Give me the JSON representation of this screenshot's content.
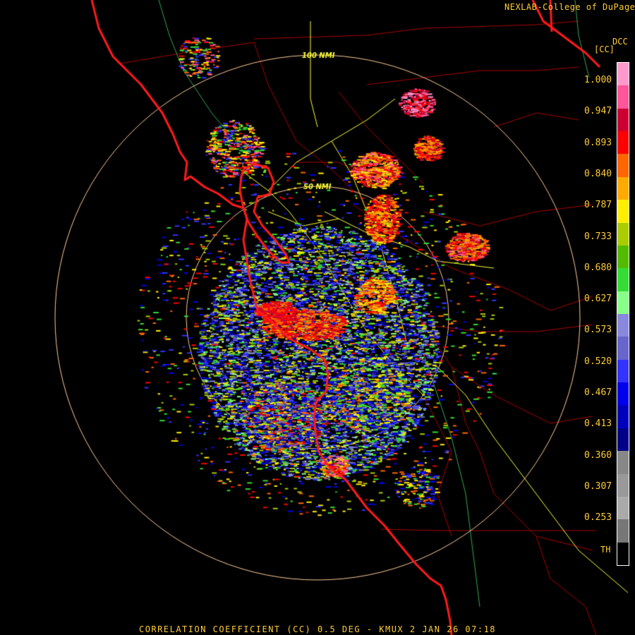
{
  "header": {
    "credit": "NEXLAB-College of DuPage",
    "credit_icon": "external-link-icon",
    "product_id": "DCC",
    "product_unit": "[CC]"
  },
  "footer": {
    "caption": "CORRELATION COEFFICIENT (CC) 0.5 DEG - KMUX 2 JAN 26 07:18"
  },
  "range_rings": [
    {
      "label": "50 NMI"
    },
    {
      "label": "100 NMI"
    }
  ],
  "legend": {
    "ticks": [
      "1.000",
      "0.947",
      "0.893",
      "0.840",
      "0.787",
      "0.733",
      "0.680",
      "0.627",
      "0.573",
      "0.520",
      "0.467",
      "0.413",
      "0.360",
      "0.307",
      "0.253"
    ],
    "threshold_label": "TH",
    "colors": [
      "#ff99cc",
      "#ff5599",
      "#cc0033",
      "#ff0000",
      "#ff6600",
      "#ffaa00",
      "#ffee00",
      "#aacc00",
      "#55bb00",
      "#33dd33",
      "#88ff88",
      "#8888dd",
      "#6666cc",
      "#3333ff",
      "#0000ee",
      "#0000bb",
      "#000088",
      "#888888",
      "#999999",
      "#aaaaaa",
      "#777777",
      "#000000"
    ]
  },
  "colors": {
    "text": "#ffcc33",
    "coastline": "#ff1a1a",
    "county_lines": "#aa0000",
    "highways": "#ffff33",
    "range_rings": "#ffcc99",
    "background": "#000000"
  }
}
